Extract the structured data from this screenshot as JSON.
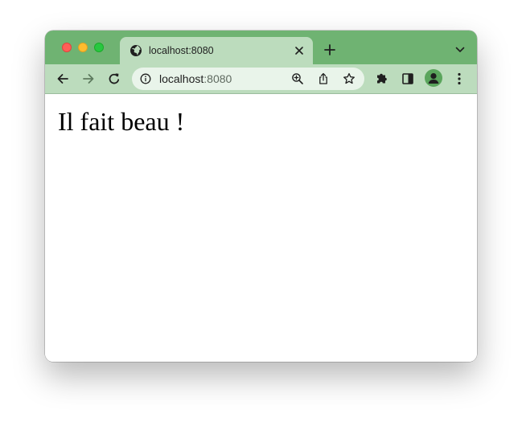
{
  "browser": {
    "tab": {
      "title": "localhost:8080",
      "favicon": "globe-icon"
    },
    "toolbar": {
      "back_icon": "arrow-left-icon",
      "forward_icon": "arrow-right-icon",
      "reload_icon": "reload-icon",
      "extensions_icon": "puzzle-icon",
      "side_panel_icon": "side-panel-icon",
      "profile_icon": "profile-icon",
      "menu_icon": "kebab-menu-icon"
    },
    "omnibox": {
      "host": "localhost",
      "port": ":8080",
      "info_icon": "info-icon",
      "zoom_icon": "zoom-icon",
      "share_icon": "share-icon",
      "bookmark_icon": "star-icon"
    },
    "colors": {
      "tabstrip": "#6fb372",
      "active_tab": "#bcdcbd",
      "omnibox": "#e9f4ea",
      "avatar": "#5aa55c"
    }
  },
  "page": {
    "heading": "Il fait beau !"
  }
}
